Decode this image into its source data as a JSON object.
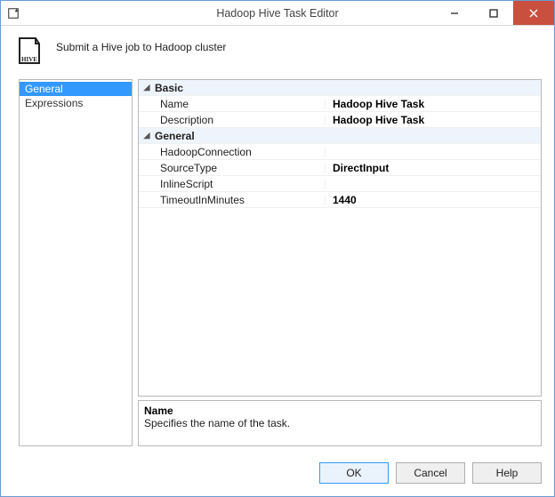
{
  "window": {
    "title": "Hadoop Hive Task Editor",
    "subtitle": "Submit a Hive job to Hadoop cluster"
  },
  "nav": {
    "items": [
      {
        "label": "General",
        "selected": true
      },
      {
        "label": "Expressions",
        "selected": false
      }
    ]
  },
  "propgrid": {
    "categories": [
      {
        "label": "Basic",
        "props": [
          {
            "name": "Name",
            "value": "Hadoop Hive Task",
            "bold": true
          },
          {
            "name": "Description",
            "value": "Hadoop Hive Task",
            "bold": true
          }
        ]
      },
      {
        "label": "General",
        "props": [
          {
            "name": "HadoopConnection",
            "value": "",
            "bold": false
          },
          {
            "name": "SourceType",
            "value": "DirectInput",
            "bold": true
          },
          {
            "name": "InlineScript",
            "value": "",
            "bold": false
          },
          {
            "name": "TimeoutInMinutes",
            "value": "1440",
            "bold": true
          }
        ]
      }
    ]
  },
  "help": {
    "name": "Name",
    "desc": "Specifies the name of the task."
  },
  "buttons": {
    "ok": "OK",
    "cancel": "Cancel",
    "help": "Help"
  },
  "winctrl": {
    "min": "—",
    "max": "▢",
    "close": "✕"
  }
}
